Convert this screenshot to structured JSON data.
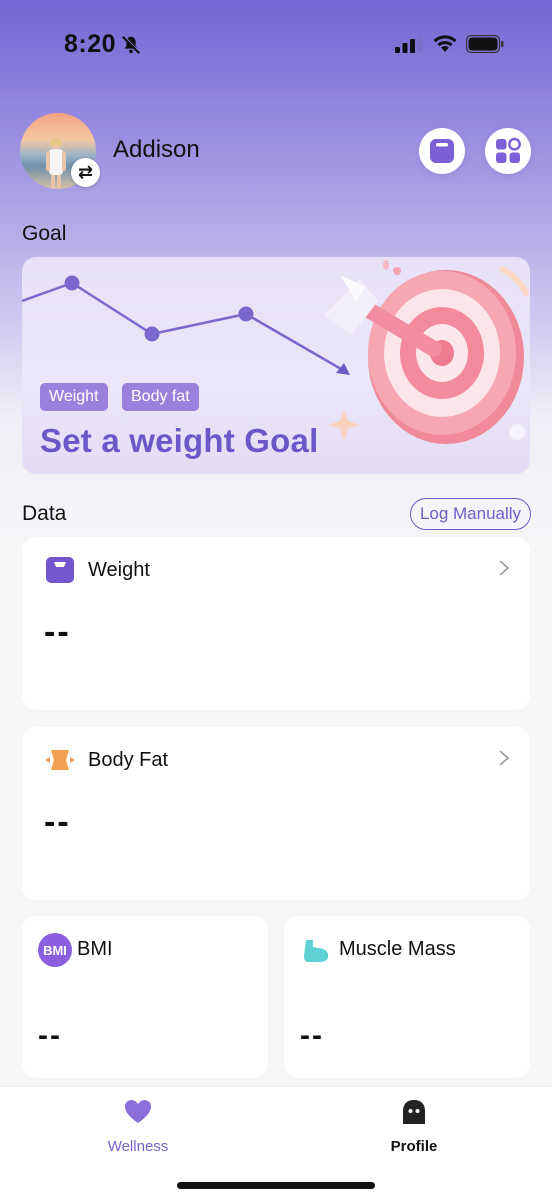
{
  "status": {
    "time": "8:20"
  },
  "header": {
    "username": "Addison"
  },
  "goal": {
    "section_title": "Goal",
    "tags": [
      "Weight",
      "Body fat"
    ],
    "cta": "Set a weight Goal"
  },
  "data": {
    "section_title": "Data",
    "log_button": "Log Manually",
    "cards": {
      "weight": {
        "title": "Weight",
        "value": "--"
      },
      "body_fat": {
        "title": "Body Fat",
        "value": "--"
      },
      "bmi": {
        "badge": "BMI",
        "title": "BMI",
        "value": "--"
      },
      "muscle": {
        "title": "Muscle Mass",
        "value": "--"
      }
    }
  },
  "tabbar": {
    "tabs": [
      {
        "label": "Wellness",
        "icon": "heart-icon",
        "active": true
      },
      {
        "label": "Profile",
        "icon": "profile-icon",
        "active": false
      }
    ]
  },
  "colors": {
    "accent": "#6e5cc8",
    "tag": "#9b80de",
    "active_tab": "#7a64c8"
  }
}
